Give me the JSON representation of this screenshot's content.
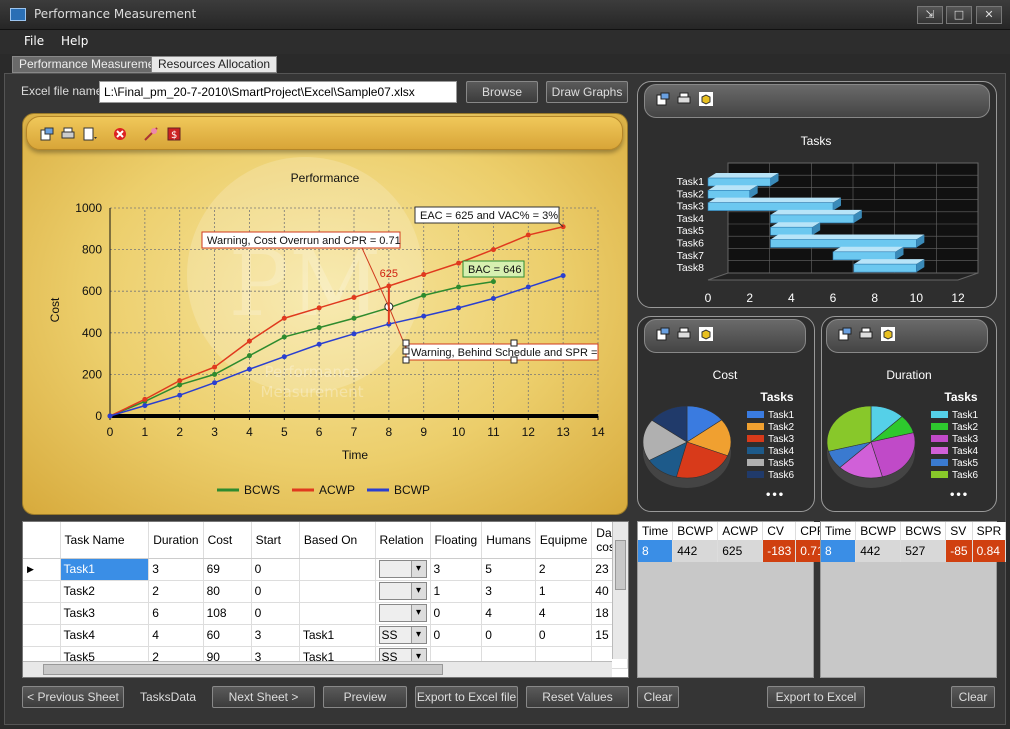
{
  "window": {
    "title": "Performance Measurement",
    "minimize": "⇲",
    "maximize": "□",
    "close": "✕"
  },
  "menu": [
    "File",
    "Help"
  ],
  "tabs": [
    "Performance Measurement",
    "Resources Allocation"
  ],
  "excel": {
    "label": "Excel file name",
    "value": "L:\\Final_pm_20-7-2010\\SmartProject\\Excel\\Sample07.xlsx",
    "browse": "Browse",
    "draw": "Draw Graphs"
  },
  "watermark": {
    "logo": "PM",
    "text1": "Performance",
    "text2": "Measurement"
  },
  "chart_data": [
    {
      "type": "line",
      "title": "Performance",
      "xlabel": "Time",
      "ylabel": "Cost",
      "xlim": [
        0,
        14
      ],
      "ylim": [
        0,
        1000
      ],
      "x_ticks": [
        "0",
        "1",
        "2",
        "3",
        "4",
        "5",
        "6",
        "7",
        "8",
        "9",
        "10",
        "11",
        "12",
        "13",
        "14"
      ],
      "y_ticks": [
        "0",
        "200",
        "400",
        "600",
        "800",
        "1000"
      ],
      "series": [
        {
          "name": "BCWS",
          "color": "#2e8b2e",
          "x": [
            0,
            1,
            2,
            3,
            4,
            5,
            6,
            7,
            8,
            9,
            10,
            11
          ],
          "values": [
            0,
            70,
            150,
            200,
            290,
            380,
            425,
            470,
            520,
            580,
            620,
            646
          ]
        },
        {
          "name": "ACWP",
          "color": "#e03a1e",
          "x": [
            0,
            1,
            2,
            3,
            4,
            5,
            6,
            7,
            8,
            9,
            10,
            11,
            12,
            13
          ],
          "values": [
            0,
            80,
            170,
            235,
            360,
            470,
            520,
            570,
            625,
            680,
            735,
            800,
            870,
            910
          ]
        },
        {
          "name": "BCWP",
          "color": "#2a3fd0",
          "x": [
            0,
            1,
            2,
            3,
            4,
            5,
            6,
            7,
            8,
            9,
            10,
            11,
            12,
            13
          ],
          "values": [
            0,
            50,
            100,
            160,
            225,
            285,
            345,
            395,
            442,
            480,
            520,
            565,
            620,
            675
          ]
        }
      ],
      "annotations": {
        "cpr": "Warning, Cost Overrun and CPR = 0.71",
        "eac": "EAC = 625 and VAC% = 3%",
        "bac": "BAC = 646",
        "spr": "Warning, Behind Schedule and SPR =",
        "point": "625"
      },
      "grid": true,
      "legend": "bottom"
    },
    {
      "type": "bar",
      "title": "Tasks",
      "orientation": "horizontal",
      "categories": [
        "Task1",
        "Task2",
        "Task3",
        "Task4",
        "Task5",
        "Task6",
        "Task7",
        "Task8"
      ],
      "starts": [
        0,
        0,
        0,
        3,
        3,
        3,
        6,
        7
      ],
      "durations": [
        3,
        2,
        6,
        4,
        2,
        7,
        3,
        3
      ],
      "xlim": [
        0,
        12
      ],
      "x_ticks": [
        "0",
        "2",
        "4",
        "6",
        "8",
        "10",
        "12"
      ],
      "grid": true
    },
    {
      "type": "pie",
      "title": "Cost",
      "legend_title": "Tasks",
      "legend": "right",
      "categories": [
        "Task1",
        "Task2",
        "Task3",
        "Task4",
        "Task5",
        "Task6"
      ],
      "values": [
        69,
        80,
        108,
        60,
        90,
        70
      ],
      "colors": [
        "#3a7be0",
        "#f0a030",
        "#d83a1a",
        "#1d5a8a",
        "#b0b0b0",
        "#203a6a"
      ],
      "more": "•••"
    },
    {
      "type": "pie",
      "title": "Duration",
      "legend_title": "Tasks",
      "legend": "right",
      "categories": [
        "Task1",
        "Task2",
        "Task3",
        "Task4",
        "Task5",
        "Task6"
      ],
      "values": [
        3,
        2,
        6,
        4,
        2,
        7
      ],
      "colors": [
        "#55d0e8",
        "#2ec82e",
        "#c04ac8",
        "#d060d8",
        "#3a7ad0",
        "#88c82a"
      ],
      "more": "•••"
    }
  ],
  "grid": {
    "columns": [
      "Task Name",
      "Duration",
      "Cost",
      "Start",
      "Based On",
      "Relation",
      "Floating",
      "Humans",
      "Equipme",
      "Daily cost"
    ],
    "rows": [
      [
        "Task1",
        "3",
        "69",
        "0",
        "",
        "",
        "3",
        "5",
        "2",
        "23"
      ],
      [
        "Task2",
        "2",
        "80",
        "0",
        "",
        "",
        "1",
        "3",
        "1",
        "40"
      ],
      [
        "Task3",
        "6",
        "108",
        "0",
        "",
        "",
        "0",
        "4",
        "4",
        "18"
      ],
      [
        "Task4",
        "4",
        "60",
        "3",
        "Task1",
        "SS",
        "0",
        "0",
        "0",
        "15"
      ],
      [
        "Task5",
        "2",
        "90",
        "3",
        "Task1",
        "SS",
        "",
        "",
        "",
        ""
      ]
    ]
  },
  "cost_table": {
    "headers": [
      "Time",
      "BCWP",
      "ACWP",
      "CV",
      "CPR"
    ],
    "row": [
      "8",
      "442",
      "625",
      "-183",
      "0.71"
    ]
  },
  "sched_table": {
    "headers": [
      "Time",
      "BCWP",
      "BCWS",
      "SV",
      "SPR"
    ],
    "row": [
      "8",
      "442",
      "527",
      "-85",
      "0.84"
    ]
  },
  "buttons": {
    "prev": "< Previous Sheet",
    "sheet": "TasksData",
    "next": "Next Sheet >",
    "preview": "Preview",
    "export": "Export to Excel file",
    "reset": "Reset Values",
    "clear1": "Clear",
    "export2": "Export to Excel",
    "clear2": "Clear"
  },
  "colors": {
    "accent": "#3a8ee6",
    "warn": "#d04010"
  }
}
